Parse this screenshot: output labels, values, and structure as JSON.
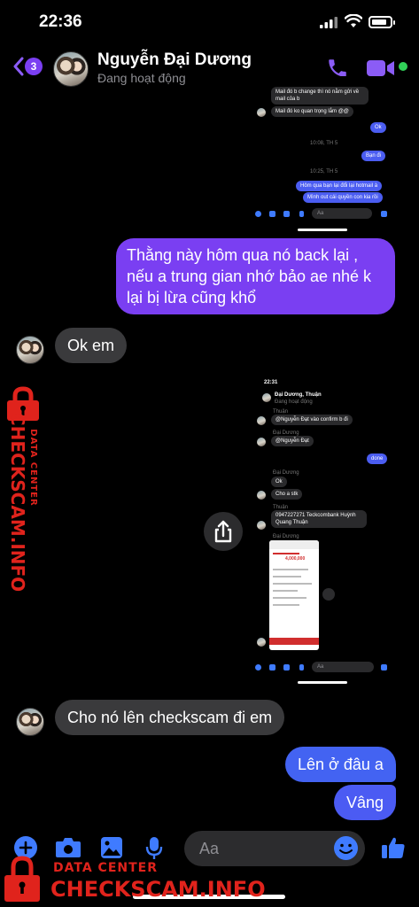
{
  "status_bar": {
    "time": "22:36"
  },
  "header": {
    "back_badge": "3",
    "name": "Nguyễn Đại Dương",
    "status": "Đang hoạt động"
  },
  "embedded_top": {
    "lines": [
      "Mail đó b change thì nó nằm gửi về mail của b",
      "Mail đó ko quan trọng lắm @@",
      "10:08, TH 5",
      "10:25, TH 5"
    ],
    "blue": [
      "Ok",
      "Bạn đi",
      "Hôm qua bạn lại đổi lại hotmail à",
      "Mình out cái quyền con kia rồi"
    ],
    "input_placeholder": "Aa"
  },
  "embedded_bottom": {
    "time": "22:31",
    "title": "Đại Dương, Thuận",
    "subtitle": "Đang hoạt động",
    "sender1": "Thuận",
    "msg1": "@Nguyễn Đạt vào confirm b đi",
    "sender2": "Đại Dương",
    "msg2": "@Nguyễn Đạt",
    "blue1": "done",
    "sender3": "Đại Dương",
    "msg3": "Ok",
    "msg4": "Cho a stk",
    "sender4": "Thuận",
    "msg5a": "0947227271 Teckcombank Huỳnh",
    "msg5b": "Quang Thuận",
    "sender5": "Đại Dương",
    "amount": "4,000,000",
    "input_placeholder": "Aa"
  },
  "messages": {
    "outgoing_1": [
      "Thằng này hôm qua nó back lại ,",
      "nếu a trung gian nhớ bảo ae nhé k",
      "lại bị lừa cũng khổ"
    ],
    "incoming_1": "Ok em",
    "incoming_2": "Cho nó lên checkscam đi em",
    "outgoing_2": "Lên ở đâu a",
    "outgoing_3": "Vâng"
  },
  "composer": {
    "placeholder": "Aa"
  },
  "watermark": {
    "side_small": "DATA CENTER",
    "side_big": "CHECKSCAM.INFO",
    "bottom_small": "DATA CENTER",
    "bottom_big": "CHECKSCAM.INFO"
  },
  "colors": {
    "accent_purple": "#7a3ff2",
    "accent_blue": "#4363f2",
    "incoming_bubble": "#3a3a3c",
    "watermark_red": "#e0231c"
  }
}
